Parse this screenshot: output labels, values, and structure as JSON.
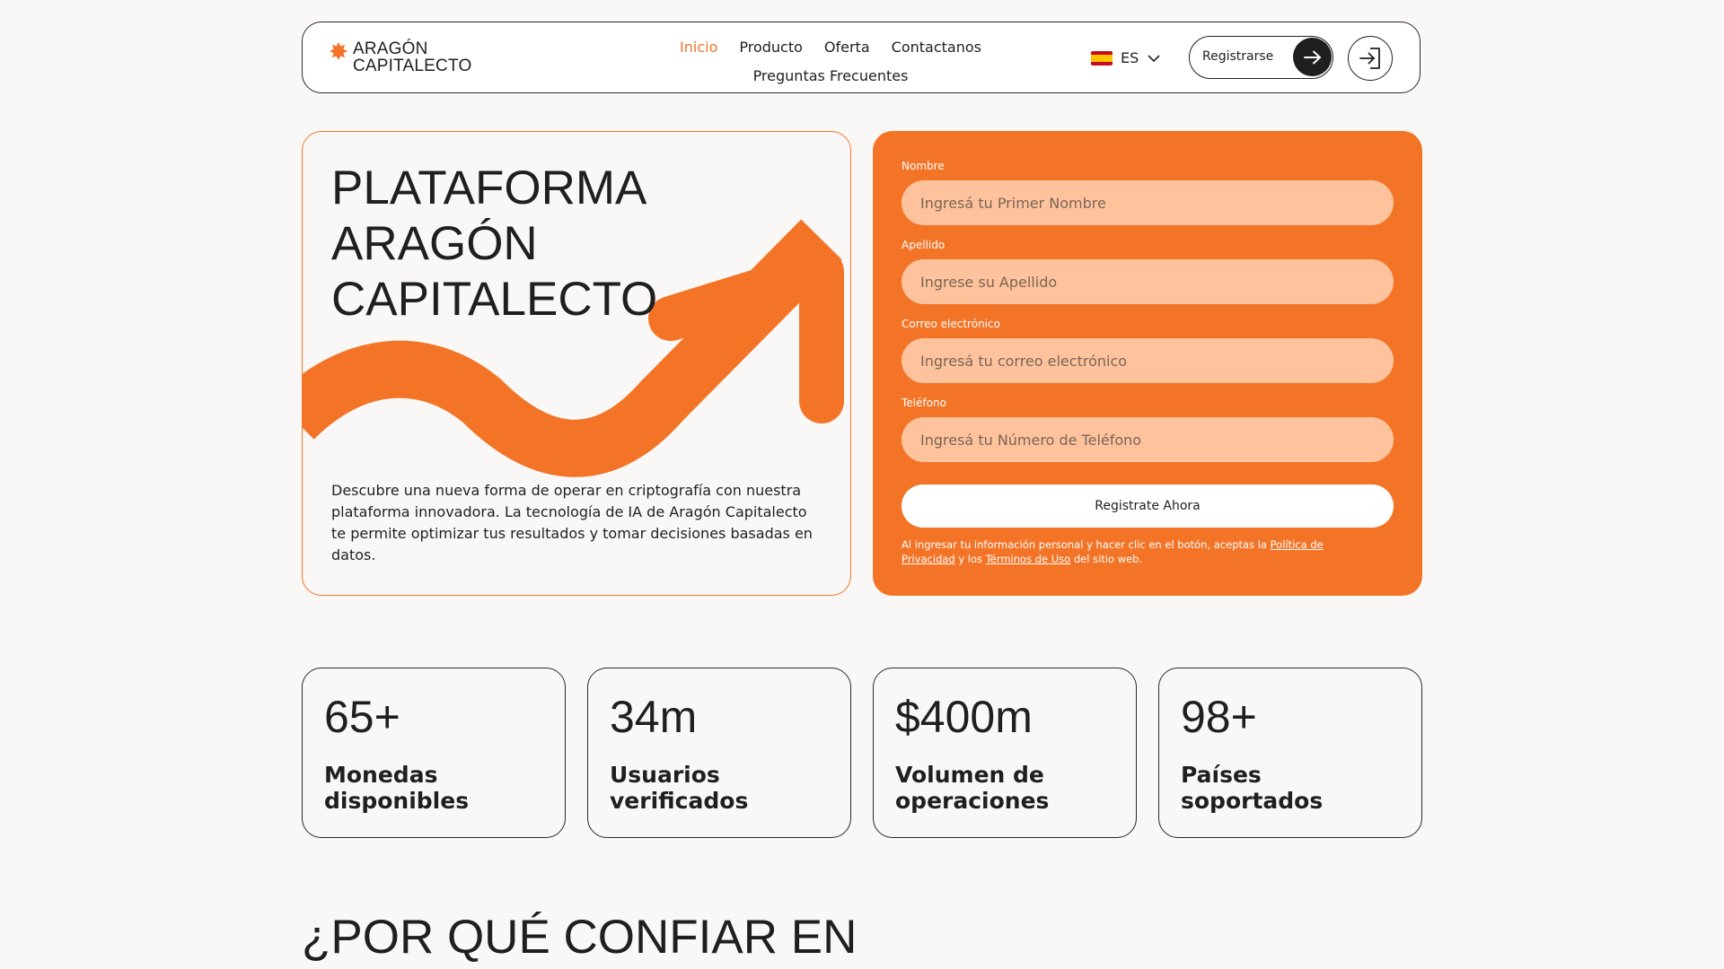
{
  "header": {
    "logo_line1": "ARAGÓN",
    "logo_line2": "CAPITALECTO",
    "nav": [
      {
        "label": "Inicio",
        "active": true
      },
      {
        "label": "Producto"
      },
      {
        "label": "Oferta"
      },
      {
        "label": "Contactanos"
      },
      {
        "label": "Preguntas Frecuentes"
      }
    ],
    "language": "ES",
    "register_label": "Registrarse"
  },
  "hero": {
    "title_line1": "PLATAFORMA",
    "title_line2": "ARAGÓN",
    "title_line3": "CAPITALECTO",
    "description": "Descubre una nueva forma de operar en criptografía con nuestra plataforma innovadora. La tecnología de IA de Aragón Capitalecto te permite optimizar tus resultados y tomar decisiones basadas en datos."
  },
  "form": {
    "first_name_label": "Nombre",
    "first_name_placeholder": "Ingresá tu Primer Nombre",
    "last_name_label": "Apellido",
    "last_name_placeholder": "Ingrese su Apellido",
    "email_label": "Correo electrónico",
    "email_placeholder": "Ingresá tu correo electrónico",
    "phone_label": "Teléfono",
    "phone_placeholder": "Ingresá tu Número de Teléfono",
    "submit_label": "Registrate Ahora",
    "legal_prefix": "Al ingresar tu información personal y hacer clic en el botón, aceptas la ",
    "privacy_link": "Política de Privacidad",
    "legal_middle": " y los ",
    "terms_link": "Términos de Uso",
    "legal_suffix": " del sitio web."
  },
  "stats": [
    {
      "value": "65+",
      "label": "Monedas disponibles"
    },
    {
      "value": "34m",
      "label": "Usuarios verificados"
    },
    {
      "value": "$400m",
      "label": "Volumen de operaciones"
    },
    {
      "value": "98+",
      "label": "Países soportados"
    }
  ],
  "section": {
    "title": "¿POR QUÉ CONFIAR EN"
  },
  "colors": {
    "accent": "#f47427",
    "input_bg": "#fec39d",
    "dark": "#1f1f1f",
    "page_bg": "#faf8f6"
  },
  "icons": {
    "logo": "sun-star-icon",
    "register": "arrow-right-icon",
    "login": "login-door-icon",
    "language": "spain-flag-icon",
    "dropdown": "chevron-down-icon"
  }
}
